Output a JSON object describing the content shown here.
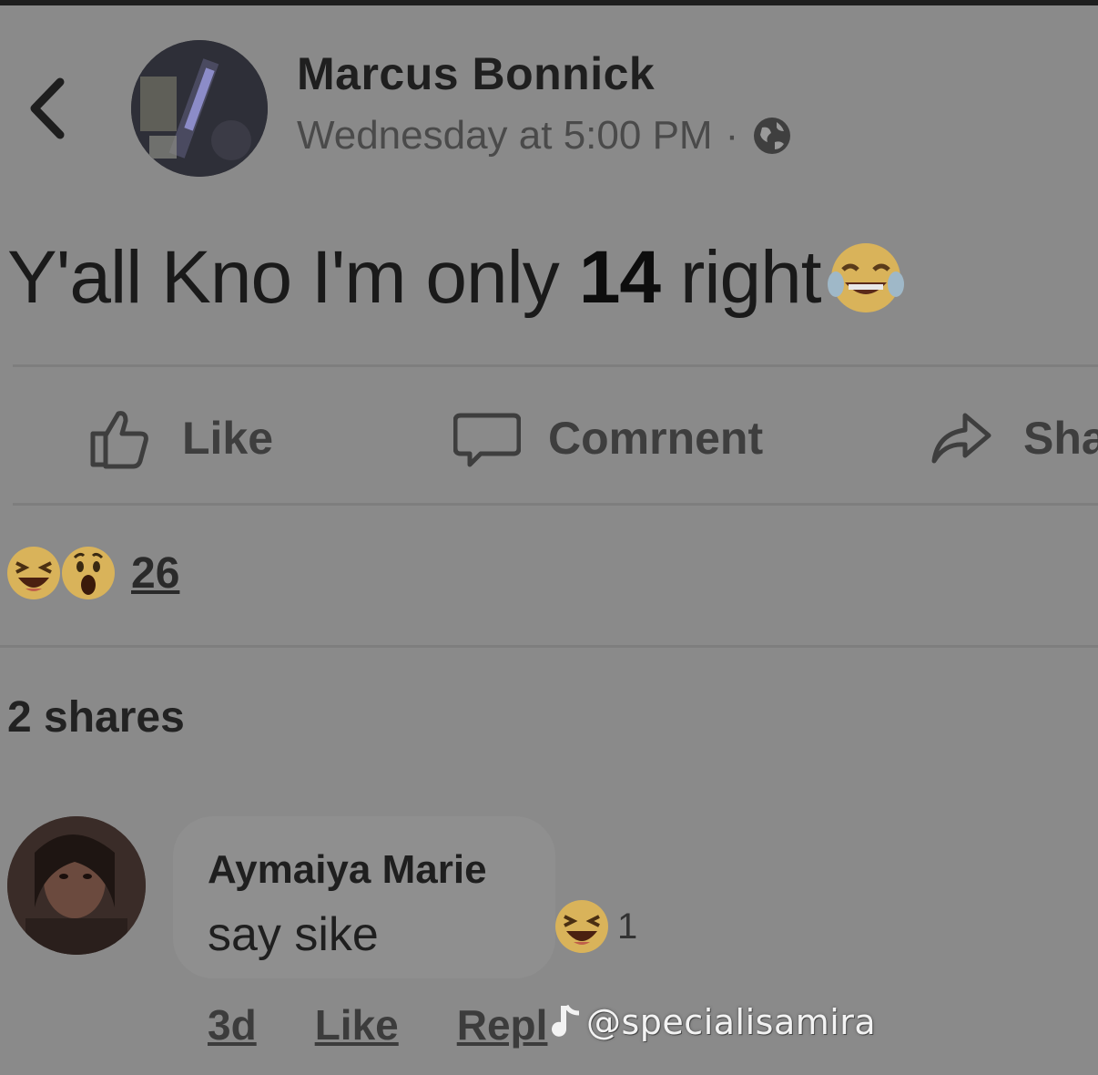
{
  "post": {
    "author": "Marcus Bonnick",
    "timestamp": "Wednesday at 5:00 PM",
    "separator": "·",
    "text_before": "Y'all Kno I'm only",
    "text_number": "14",
    "text_after": "right",
    "emoji": "face-with-tears-of-joy"
  },
  "actions": {
    "like_label": "Like",
    "comment_label": "Comrnent",
    "share_label": "Sha"
  },
  "reactions": {
    "icons": [
      "laughing-face",
      "surprised-face"
    ],
    "count": "26"
  },
  "shares_label": "2 shares",
  "comment": {
    "author": "Aymaiya Marie",
    "text": "say sike",
    "reaction_icon": "laughing-face",
    "reaction_count": "1",
    "time": "3d",
    "like_label": "Like",
    "reply_label": "Repl"
  },
  "watermark": {
    "handle": "@specialisamira"
  },
  "colors": {
    "background": "#8a8a8a",
    "emoji_yellow": "#d9b35a"
  }
}
